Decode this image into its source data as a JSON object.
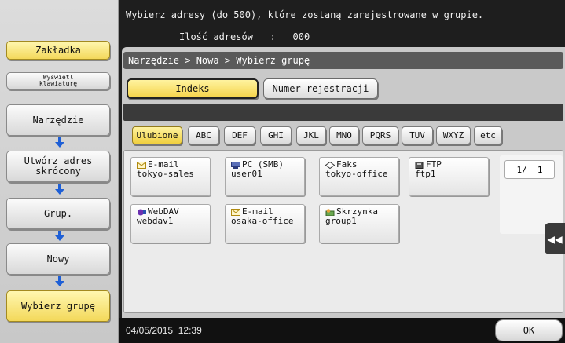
{
  "header": {
    "message": "Wybierz adresy (do 500), które zostaną zarejestrowane w grupie.",
    "count_label": "Ilość adresów",
    "count_sep": ":",
    "count_value": "000"
  },
  "sidebar": {
    "tab_label": "Zakładka",
    "keyboard_label": "Wyświetl klawiaturę",
    "steps": [
      {
        "label": "Narzędzie"
      },
      {
        "label": "Utwórz adres skrócony"
      },
      {
        "label": "Grup."
      },
      {
        "label": "Nowy"
      },
      {
        "label": "Wybierz grupę"
      }
    ]
  },
  "breadcrumb": "Narzędzie > Nowa > Wybierz grupę",
  "tabs": [
    {
      "label": "Indeks",
      "active": true
    },
    {
      "label": "Numer rejestracji",
      "active": false
    }
  ],
  "filters": [
    {
      "label": "Ulubione",
      "active": true
    },
    {
      "label": "ABC"
    },
    {
      "label": "DEF"
    },
    {
      "label": "GHI"
    },
    {
      "label": "JKL"
    },
    {
      "label": "MNO"
    },
    {
      "label": "PQRS"
    },
    {
      "label": "TUV"
    },
    {
      "label": "WXYZ"
    },
    {
      "label": "etc"
    }
  ],
  "entries": [
    {
      "type": "E-mail",
      "name": "tokyo-sales",
      "icon": "email-icon"
    },
    {
      "type": "PC (SMB)",
      "name": "user01",
      "icon": "pc-icon"
    },
    {
      "type": "Faks",
      "name": "tokyo-office",
      "icon": "fax-icon"
    },
    {
      "type": "FTP",
      "name": "ftp1",
      "icon": "ftp-icon"
    },
    {
      "type": "WebDAV",
      "name": "webdav1",
      "icon": "webdav-icon"
    },
    {
      "type": "E-mail",
      "name": "osaka-office",
      "icon": "email-icon"
    },
    {
      "type": "Skrzynka",
      "name": "group1",
      "icon": "box-icon"
    }
  ],
  "pager": "1/  1",
  "side_tab": "◀◀",
  "footer": {
    "datetime": "04/05/2015  12:39",
    "ok_label": "OK"
  }
}
